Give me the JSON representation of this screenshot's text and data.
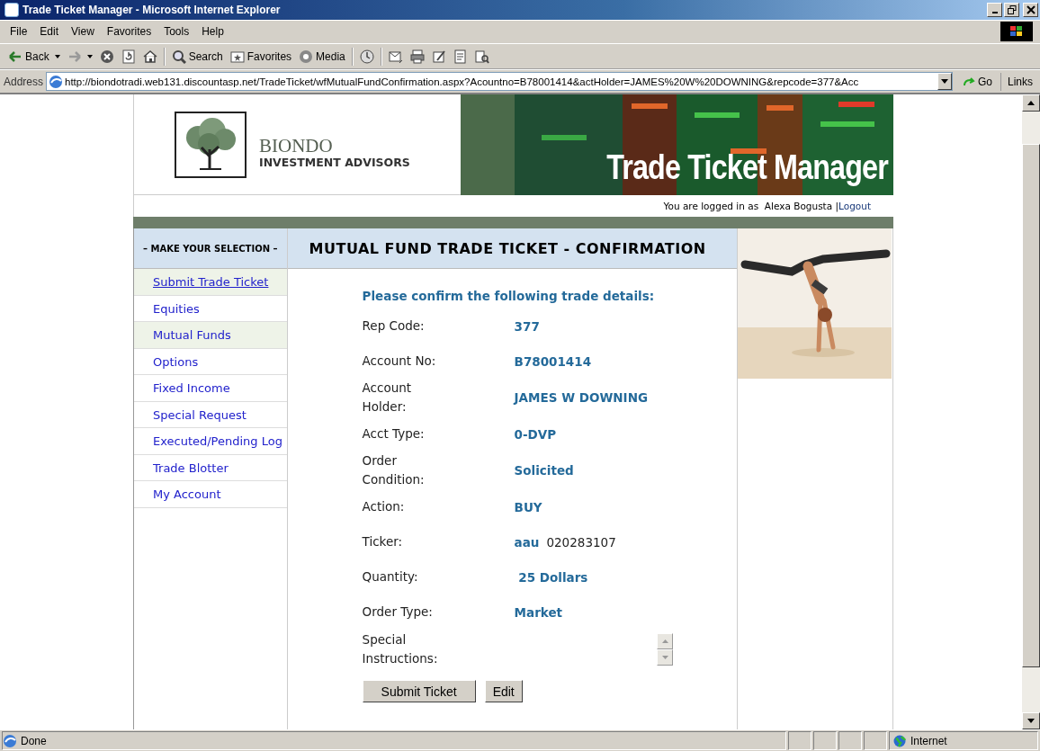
{
  "window": {
    "title": "Trade Ticket Manager - Microsoft Internet Explorer"
  },
  "menu": [
    "File",
    "Edit",
    "View",
    "Favorites",
    "Tools",
    "Help"
  ],
  "toolbar": [
    {
      "kind": "back",
      "label": "Back"
    },
    {
      "kind": "forward"
    },
    {
      "kind": "stop"
    },
    {
      "kind": "refresh"
    },
    {
      "kind": "home"
    },
    {
      "kind": "search",
      "label": "Search"
    },
    {
      "kind": "favorites",
      "label": "Favorites"
    },
    {
      "kind": "media",
      "label": "Media"
    },
    {
      "kind": "history"
    },
    {
      "kind": "mail"
    },
    {
      "kind": "print"
    },
    {
      "kind": "edit"
    },
    {
      "kind": "discuss"
    },
    {
      "kind": "research"
    }
  ],
  "address": {
    "label": "Address",
    "url": "http://biondotradi.web131.discountasp.net/TradeTicket/wfMutualFundConfirmation.aspx?Acountno=B78001414&actHolder=JAMES%20W%20DOWNING&repcode=377&Acc",
    "go": "Go",
    "links": "Links"
  },
  "page": {
    "brand": {
      "name": "BIONDO",
      "tagline": "INVESTMENT ADVISORS"
    },
    "banner_title": "Trade Ticket Manager",
    "login": {
      "text": "You are logged in as  Alexa Bogusta |",
      "link": "Logout"
    },
    "sidebar": {
      "heading": "– MAKE YOUR SELECTION –",
      "items": [
        {
          "label": "Submit Trade Ticket",
          "selected": true,
          "underlined": true
        },
        {
          "label": "Equities",
          "selected": false,
          "underlined": false
        },
        {
          "label": "Mutual Funds",
          "selected": true,
          "underlined": false
        },
        {
          "label": "Options",
          "selected": false,
          "underlined": false
        },
        {
          "label": "Fixed Income",
          "selected": false,
          "underlined": false
        },
        {
          "label": "Special Request",
          "selected": false,
          "underlined": false
        },
        {
          "label": "Executed/Pending Log",
          "selected": false,
          "underlined": false
        },
        {
          "label": "Trade Blotter",
          "selected": false,
          "underlined": false
        },
        {
          "label": "My Account",
          "selected": false,
          "underlined": false
        }
      ]
    },
    "heading": "MUTUAL FUND TRADE TICKET - CONFIRMATION",
    "intro": "Please confirm the following trade details:",
    "fields": [
      {
        "kind": "text",
        "label": "Rep Code:",
        "value": "377"
      },
      {
        "kind": "text",
        "label": "Account No:",
        "value": "B78001414"
      },
      {
        "kind": "text",
        "label": "Account Holder:",
        "value": "JAMES W DOWNING"
      },
      {
        "kind": "text",
        "label": "Acct Type:",
        "value": "0-DVP"
      },
      {
        "kind": "text",
        "label": "Order Condition:",
        "value": "Solicited"
      },
      {
        "kind": "text",
        "label": "Action:",
        "value": "BUY"
      },
      {
        "kind": "text",
        "label": "Ticker:",
        "value": "aau",
        "extra": "020283107"
      },
      {
        "kind": "text",
        "label": "Quantity:",
        "value": " 25 Dollars"
      },
      {
        "kind": "text",
        "label": "Order Type:",
        "value": "Market"
      },
      {
        "kind": "textarea",
        "label": "Special Instructions:"
      }
    ],
    "buttons": [
      "Submit Ticket",
      "Edit"
    ]
  },
  "status_bar": {
    "text": "Done",
    "zone": "Internet"
  }
}
